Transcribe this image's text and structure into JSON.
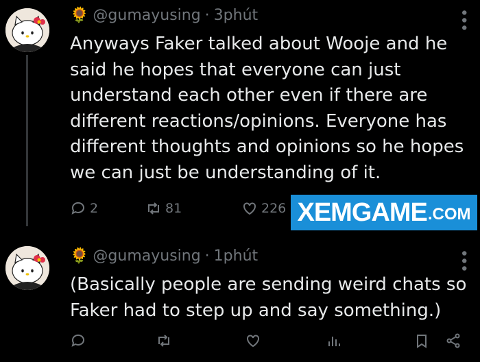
{
  "tweets": [
    {
      "handle": "@gumayusing",
      "separator": "·",
      "time": "3phút",
      "text": "Anyways Faker talked about Wooje and he said he hopes that everyone can just understand each other even if there are different reactions/opinions. Everyone has different thoughts and opinions so he hopes we can just be understanding of it.",
      "replies": "2",
      "retweets": "81",
      "likes": "226"
    },
    {
      "handle": "@gumayusing",
      "separator": "·",
      "time": "1phút",
      "text": "(Basically people are sending weird chats so Faker had to step up and say something.)"
    }
  ],
  "icons": {
    "flower": "🌻",
    "more": "⋮"
  },
  "watermark": {
    "main": "XEMGAME",
    "suffix": ".COM",
    "color": "#1a8fd8"
  }
}
